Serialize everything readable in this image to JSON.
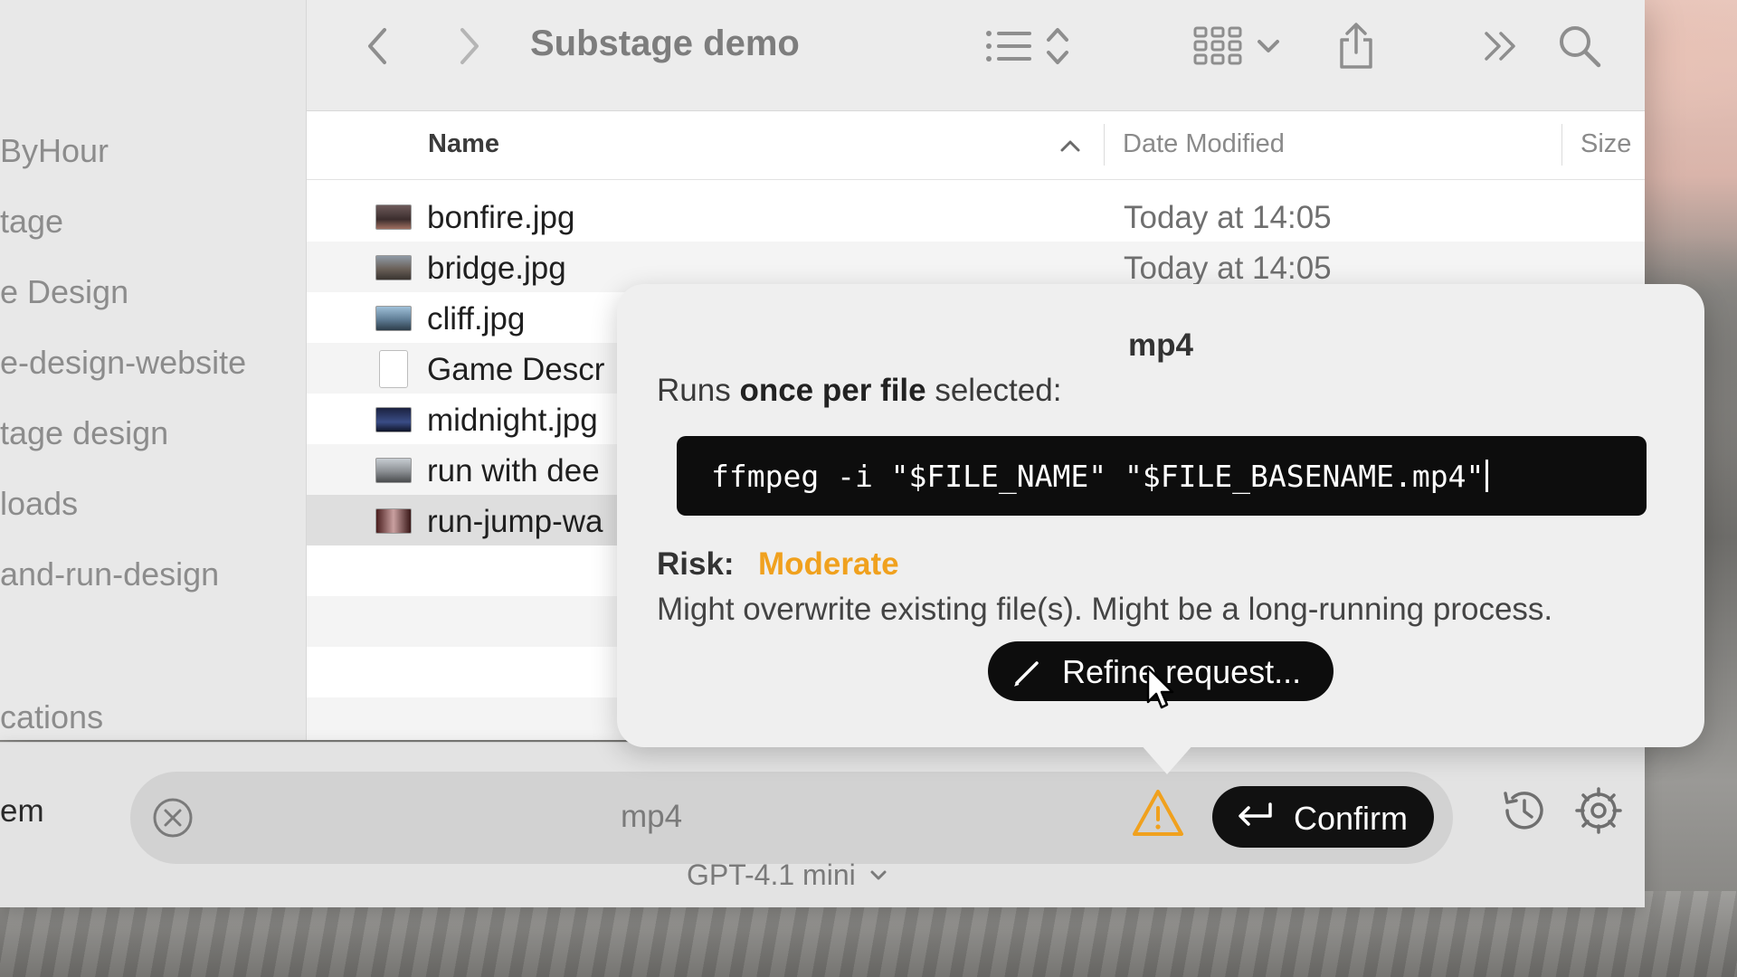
{
  "window": {
    "title": "Substage demo"
  },
  "sidebar": {
    "items": [
      {
        "label": "ByHour"
      },
      {
        "label": "tage"
      },
      {
        "label": "e Design"
      },
      {
        "label": "e-design-website"
      },
      {
        "label": "tage design"
      },
      {
        "label": "loads"
      },
      {
        "label": "and-run-design"
      },
      {
        "label": "cations"
      }
    ]
  },
  "columns": {
    "name": "Name",
    "date": "Date Modified",
    "size": "Size"
  },
  "files": [
    {
      "name": "bonfire.jpg",
      "date": "Today at 14:05"
    },
    {
      "name": "bridge.jpg",
      "date": "Today at 14:05"
    },
    {
      "name": "cliff.jpg",
      "date": ""
    },
    {
      "name": "Game Descr",
      "date": ""
    },
    {
      "name": "midnight.jpg",
      "date": ""
    },
    {
      "name": "run with dee",
      "date": ""
    },
    {
      "name": "run-jump-wa",
      "date": ""
    }
  ],
  "popover": {
    "title": "mp4",
    "runs_prefix": "Runs ",
    "runs_bold": "once per file",
    "runs_suffix": " selected:",
    "command": "ffmpeg -i \"$FILE_NAME\" \"$FILE_BASENAME.mp4\"",
    "risk_label": "Risk:",
    "risk_value": "Moderate",
    "risk_description": "Might overwrite existing file(s). Might be a long-running process.",
    "refine_label": "Refine request..."
  },
  "bar": {
    "left_label": "em",
    "prompt_text": "mp4",
    "confirm_label": "Confirm",
    "model": "GPT-4.1 mini"
  },
  "colors": {
    "risk_moderate": "#f0a11e",
    "command_bg": "#0d0d0d",
    "warning_icon": "#f0a11e"
  },
  "icons": [
    "back-chevron-icon",
    "forward-chevron-icon",
    "list-view-icon",
    "sort-icon",
    "grid-view-icon",
    "chevron-down-icon",
    "share-icon",
    "more-chevrons-icon",
    "search-icon",
    "sort-ascending-icon",
    "clear-icon",
    "warning-icon",
    "return-icon",
    "history-icon",
    "settings-icon",
    "pencil-icon",
    "cursor-icon"
  ]
}
